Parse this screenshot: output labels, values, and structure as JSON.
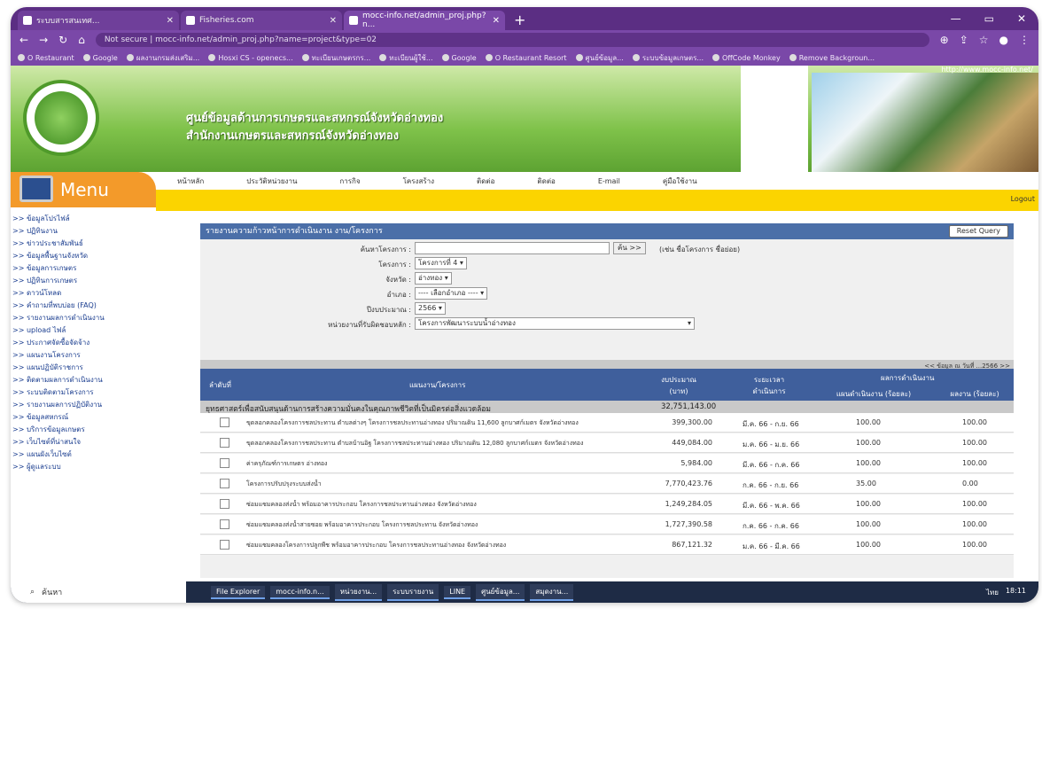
{
  "browser": {
    "tabs": [
      {
        "title": "ระบบสารสนเทศ...",
        "active": false
      },
      {
        "title": "Fisheries.com",
        "active": false
      },
      {
        "title": "mocc-info.net/admin_proj.php?n...",
        "active": true
      }
    ],
    "window_controls": [
      "—",
      "▭",
      "✕"
    ],
    "url": "Not secure | mocc-info.net/admin_proj.php?name=project&type=02",
    "bookmarks": [
      "O Restaurant",
      "Google",
      "ผลงานกรมส่งเสริม...",
      "Hosxi CS - openecs...",
      "ทะเบียนเกษตรกร...",
      "ทะเบียนผู้ใช้...",
      "Google",
      "O Restaurant Resort",
      "ศูนย์ข้อมูล...",
      "ระบบข้อมูลเกษตร...",
      "OffCode Monkey",
      "Remove Backgroun..."
    ]
  },
  "header": {
    "site_url": "http://www.mocc-info.net/",
    "title_line1": "ศูนย์ข้อมูลด้านการเกษตรและสหกรณ์จังหวัดอ่างทอง",
    "title_line2": "สำนักงานเกษตรและสหกรณ์จังหวัดอ่างทอง",
    "menu_label": "Menu"
  },
  "navbar": [
    "หน้าหลัก",
    "ประวัติหน่วยงาน",
    "การกิจ",
    "โครงสร้าง",
    "ติดต่อ",
    "ติดต่อ",
    "E-mail",
    "คู่มือใช้งาน"
  ],
  "logout_label": "Logout",
  "sidebar": [
    ">> ข้อมูลโปรไฟล์",
    ">> ปฏิทินงาน",
    ">> ข่าวประชาสัมพันธ์",
    ">> ข้อมูลพื้นฐานจังหวัด",
    ">> ข้อมูลการเกษตร",
    ">> ปฏิทินการเกษตร",
    ">> ดาวน์โหลด",
    ">> คำถามที่พบบ่อย (FAQ)",
    ">> รายงานผลการดำเนินงาน",
    ">> upload ไฟล์",
    ">> ประกาศจัดซื้อจัดจ้าง",
    ">> แผนงานโครงการ",
    ">> แผนปฏิบัติราชการ",
    ">> ติดตามผลการดำเนินงาน",
    ">> ระบบติดตามโครงการ",
    ">> รายงานผลการปฏิบัติงาน",
    ">> ข้อมูลสหกรณ์",
    ">> บริการข้อมูลเกษตร",
    ">> เว็บไซต์ที่น่าสนใจ",
    ">> แผนผังเว็บไซต์",
    ">> ผู้ดูแลระบบ"
  ],
  "panel": {
    "title": "รายงานความก้าวหน้าการดำเนินงาน งาน/โครงการ",
    "reset_label": "Reset Query",
    "filters": {
      "project_label": "ค้นหาโครงการ :",
      "project_value": "",
      "search_btn": "ค้น >>",
      "search_note": "(เช่น ชื่อโครงการ ชื่อย่อย)",
      "type_label": "โครงการ :",
      "type_value": "โครงการที่ 4",
      "province_label": "จังหวัด :",
      "province_value": "อ่างทอง",
      "district_label": "อำเภอ :",
      "district_value": "---- เลือกอำเภอ ----",
      "year_label": "ปีงบประมาณ :",
      "year_value": "2566",
      "agency_label": "หน่วยงานที่รับผิดชอบหลัก :",
      "agency_value": "โครงการพัฒนาระบบน้ำอ่างทอง"
    },
    "note": "<< ข้อมูล ณ วันที่ ...2566 >>",
    "columns": {
      "no": "ลำดับที่",
      "name": "แผนงาน/โครงการ",
      "budget": "งบประมาณ (บาท)",
      "period": "ระยะเวลา ดำเนินการ",
      "progress_group": "ผลการดำเนินงาน",
      "plan": "แผนดำเนินงาน (ร้อยละ)",
      "actual": "ผลงาน (ร้อยละ)"
    },
    "group": {
      "name": "ยุทธศาสตร์เพื่อสนับสนุนด้านการสร้างความมั่นคงในคุณภาพชีวิตที่เป็นมิตรต่อสิ่งแวดล้อม",
      "budget": "32,751,143.00"
    },
    "rows": [
      {
        "name": "ขุดลอกคลองโครงการชลประทาน ตำบลต่างๆ โครงการชลประทานอ่างทอง ปริมาณดิน 11,600 ลูกบาศก์เมตร จังหวัดอ่างทอง",
        "budget": "399,300.00",
        "period": "มี.ค. 66 - ก.ย. 66",
        "plan": "100.00",
        "actual": "100.00"
      },
      {
        "name": "ขุดลอกคลองโครงการชลประทาน ตำบลบ้านอิฐ โครงการชลประทานอ่างทอง ปริมาณดิน 12,080 ลูกบาศก์เมตร จังหวัดอ่างทอง",
        "budget": "449,084.00",
        "period": "ม.ค. 66 - ม.ย. 66",
        "plan": "100.00",
        "actual": "100.00"
      },
      {
        "name": "ค่าครุภัณฑ์การเกษตร อ่างทอง",
        "budget": "5,984.00",
        "period": "มี.ค. 66 - ก.ค. 66",
        "plan": "100.00",
        "actual": "100.00"
      },
      {
        "name": "โครงการปรับปรุงระบบส่งน้ำ",
        "budget": "7,770,423.76",
        "period": "ก.ค. 66 - ก.ย. 66",
        "plan": "35.00",
        "actual": "0.00"
      },
      {
        "name": "ซ่อมแซมคลองส่งน้ำ พร้อมอาคารประกอบ โครงการชลประทานอ่างทอง จังหวัดอ่างทอง",
        "budget": "1,249,284.05",
        "period": "มี.ค. 66 - พ.ค. 66",
        "plan": "100.00",
        "actual": "100.00"
      },
      {
        "name": "ซ่อมแซมคลองส่งน้ำสายซอย พร้อมอาคารประกอบ โครงการชลประทาน จังหวัดอ่างทอง",
        "budget": "1,727,390.58",
        "period": "ก.ค. 66 - ก.ค. 66",
        "plan": "100.00",
        "actual": "100.00"
      },
      {
        "name": "ซ่อมแซมคลองโครงการปลูกพืช พร้อมอาคารประกอบ โครงการชลประทานอ่างทอง จังหวัดอ่างทอง",
        "budget": "867,121.32",
        "period": "ม.ค. 66 - มี.ค. 66",
        "plan": "100.00",
        "actual": "100.00"
      }
    ]
  },
  "taskbar": {
    "search_placeholder": "ค้นหา",
    "apps": [
      "File Explorer",
      "mocc-info.n...",
      "หน่วยงาน...",
      "ระบบรายงาน",
      "LINE",
      "ศูนย์ข้อมูล...",
      "สมุดงาน..."
    ],
    "clock": "18:11",
    "lang": "ไทย"
  },
  "colors": {
    "tabbar": "#5b2e83",
    "banner": "#5da332",
    "menu": "#f39a2a",
    "bar": "#fbd400",
    "table_header": "#3f5f9c"
  }
}
